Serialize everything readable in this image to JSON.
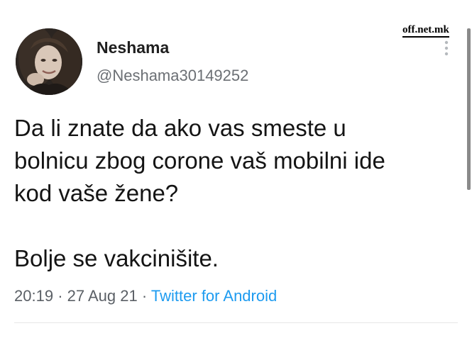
{
  "author": {
    "display_name": "Neshama",
    "handle": "@Neshama30149252",
    "avatar_icon": "profile-photo"
  },
  "tweet": {
    "lines": [
      "Da li znate da ako vas smeste u",
      "bolnicu zbog corone vaš mobilni ide",
      "kod vaše žene?",
      "Bolje se vakcinišite."
    ]
  },
  "meta": {
    "time": "20:19",
    "separator": "·",
    "date": "27 Aug 21",
    "source": "Twitter for Android"
  },
  "watermark": "off.net.mk",
  "colors": {
    "link": "#1d9bf0",
    "secondary_text": "#5b6066",
    "primary_text": "#141414"
  },
  "icons": {
    "more": "more-vertical-icon"
  }
}
